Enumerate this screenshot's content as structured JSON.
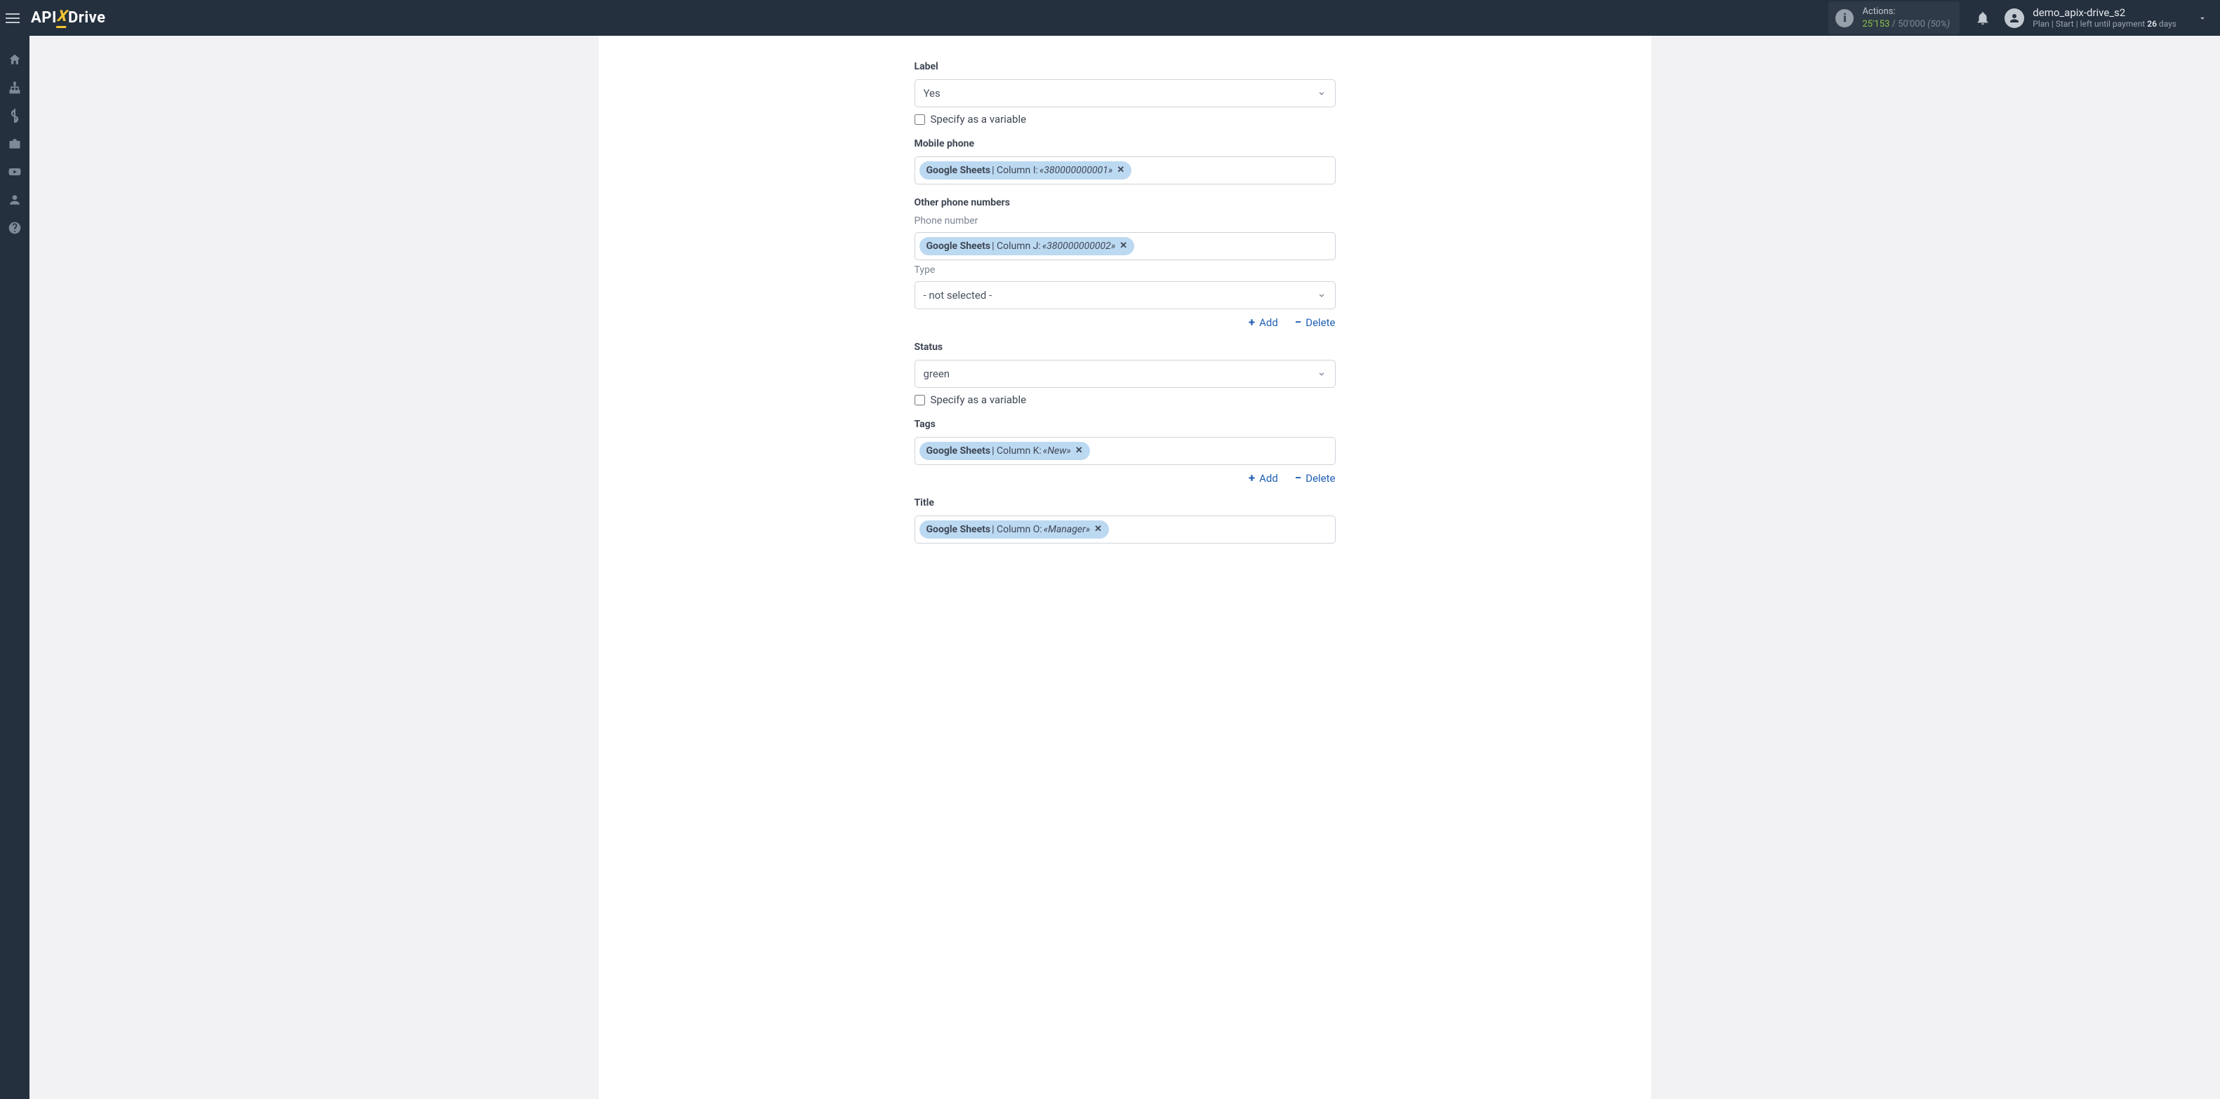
{
  "header": {
    "brand_api": "API",
    "brand_x": "X",
    "brand_drive": "Drive",
    "actions_label": "Actions:",
    "actions_used": "25'153",
    "actions_sep": "/",
    "actions_total": "50'000",
    "actions_pct": "(50%)",
    "username": "demo_apix-drive_s2",
    "plan_prefix": "Plan |",
    "plan_name": "Start",
    "plan_mid": "| left until payment",
    "plan_days": "26",
    "plan_days_suffix": "days"
  },
  "form": {
    "label": {
      "title": "Label",
      "value": "Yes",
      "checkbox": "Specify as a variable"
    },
    "mobile": {
      "title": "Mobile phone",
      "chip_src": "Google Sheets",
      "chip_col": " | Column I: ",
      "chip_val": "«380000000001»"
    },
    "other_section": "Other phone numbers",
    "other_phone": {
      "sub": "Phone number",
      "chip_src": "Google Sheets",
      "chip_col": " | Column J: ",
      "chip_val": "«380000000002»"
    },
    "type": {
      "sub": "Type",
      "value": "- not selected -"
    },
    "add_label": "Add",
    "delete_label": "Delete",
    "status": {
      "title": "Status",
      "value": "green",
      "checkbox": "Specify as a variable"
    },
    "tags": {
      "title": "Tags",
      "chip_src": "Google Sheets",
      "chip_col": " | Column K: ",
      "chip_val": "«New»"
    },
    "title_field": {
      "title": "Title",
      "chip_src": "Google Sheets",
      "chip_col": " | Column O: ",
      "chip_val": "«Manager»"
    }
  }
}
